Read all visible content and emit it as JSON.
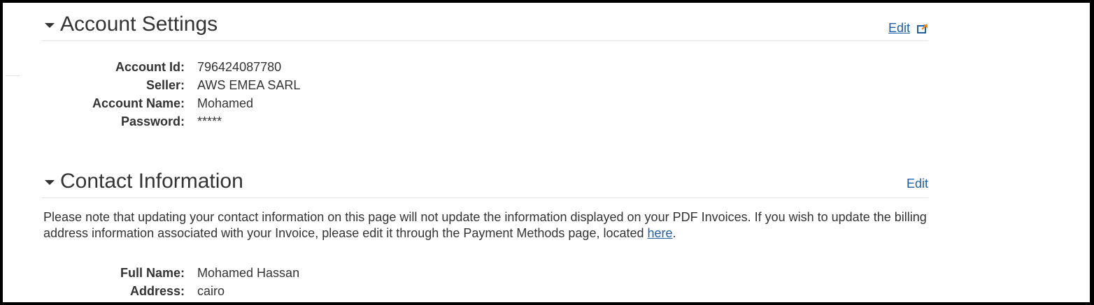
{
  "account_settings": {
    "title": "Account Settings",
    "edit_label": "Edit",
    "edit_icon": "external-link-icon",
    "accent_color": "#f08a1c",
    "fields": [
      {
        "label": "Account Id:",
        "value": "796424087780"
      },
      {
        "label": "Seller:",
        "value": "AWS EMEA SARL"
      },
      {
        "label": "Account Name:",
        "value": "Mohamed"
      },
      {
        "label": "Password:",
        "value": "*****"
      }
    ]
  },
  "contact_information": {
    "title": "Contact Information",
    "edit_label": "Edit",
    "note_text": "Please note that updating your contact information on this page will not update the information displayed on your PDF Invoices. If you wish to update the billing address information associated with your Invoice, please edit it through the Payment Methods page, located ",
    "note_link": "here",
    "note_end": ".",
    "fields": [
      {
        "label": "Full Name:",
        "value": "Mohamed Hassan"
      },
      {
        "label": "Address:",
        "value": "cairo"
      }
    ]
  },
  "link_color": "#1f5ea8"
}
